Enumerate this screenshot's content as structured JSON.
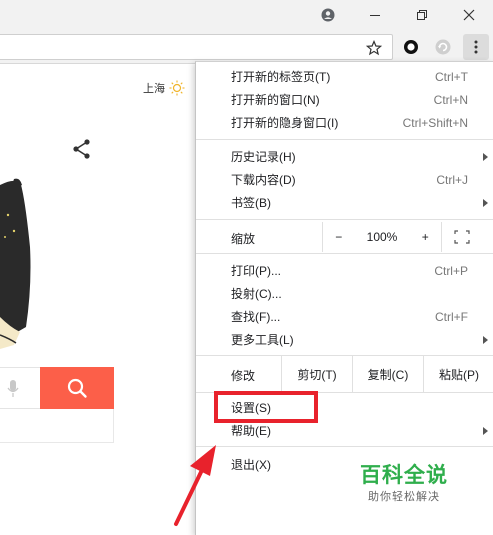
{
  "page": {
    "weather_city": "上海"
  },
  "menu": {
    "group1": [
      {
        "label": "打开新的标签页(T)",
        "shortcut": "Ctrl+T"
      },
      {
        "label": "打开新的窗口(N)",
        "shortcut": "Ctrl+N"
      },
      {
        "label": "打开新的隐身窗口(I)",
        "shortcut": "Ctrl+Shift+N"
      }
    ],
    "group2": [
      {
        "label": "历史记录(H)",
        "shortcut": ""
      },
      {
        "label": "下载内容(D)",
        "shortcut": "Ctrl+J"
      },
      {
        "label": "书签(B)",
        "shortcut": ""
      }
    ],
    "zoom": {
      "label": "缩放",
      "minus": "−",
      "value": "100%",
      "plus": "+"
    },
    "group3": [
      {
        "label": "打印(P)...",
        "shortcut": "Ctrl+P"
      },
      {
        "label": "投射(C)...",
        "shortcut": ""
      },
      {
        "label": "查找(F)...",
        "shortcut": "Ctrl+F"
      },
      {
        "label": "更多工具(L)",
        "shortcut": ""
      }
    ],
    "edit": {
      "label": "修改",
      "cut": "剪切(T)",
      "copy": "复制(C)",
      "paste": "粘贴(P)"
    },
    "group4": [
      {
        "label": "设置(S)"
      },
      {
        "label": "帮助(E)"
      }
    ],
    "exit": {
      "label": "退出(X)"
    }
  },
  "watermark": {
    "title": "百科全说",
    "subtitle": "助你轻松解决"
  },
  "colors": {
    "highlight": "#e8222c",
    "search_button": "#fc5f49",
    "watermark_green": "#2fae4c"
  }
}
